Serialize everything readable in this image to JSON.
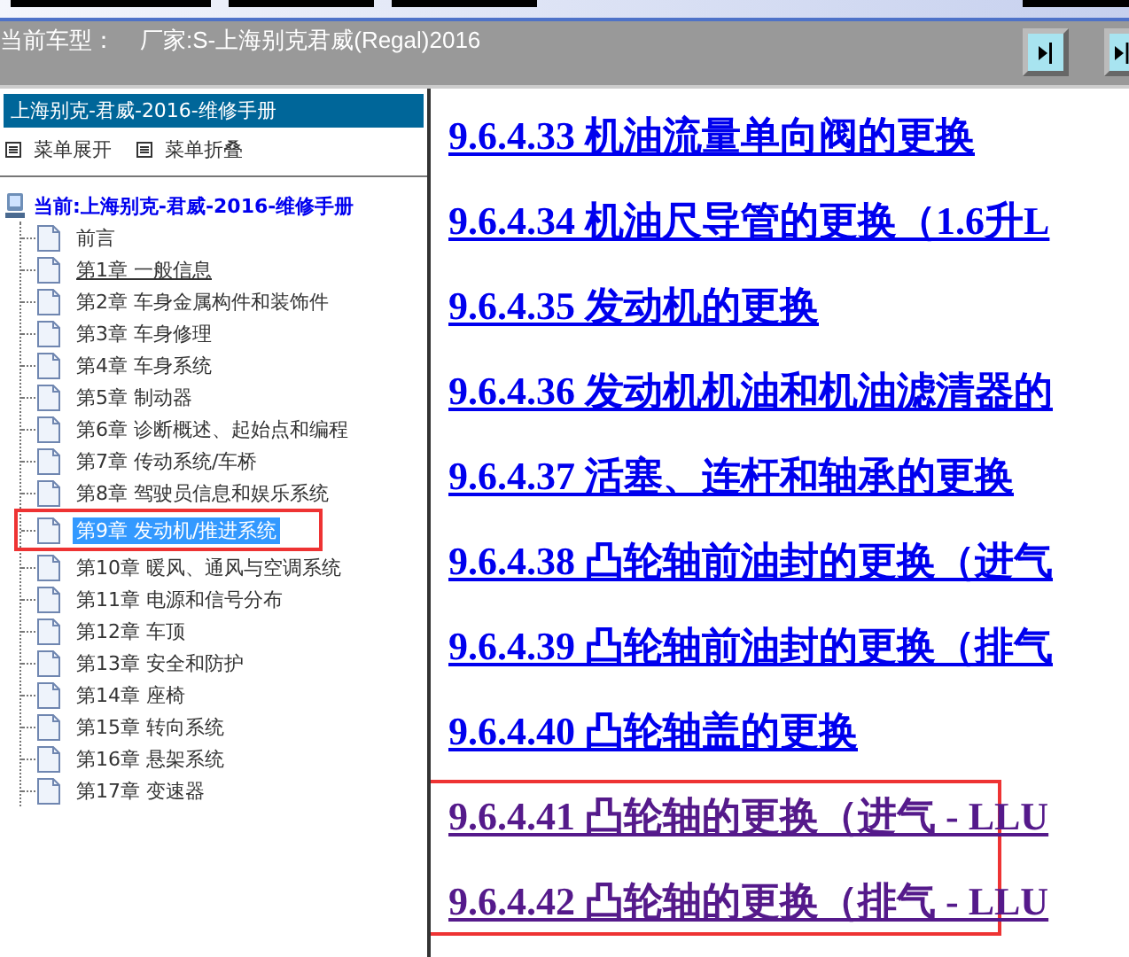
{
  "vehicle_bar": {
    "label": "当前车型：",
    "value": "厂家:S-上海别克君威(Regal)2016"
  },
  "sidebar": {
    "title": "上海别克-君威-2016-维修手册",
    "menu_actions": [
      {
        "label": "菜单展开"
      },
      {
        "label": "菜单折叠"
      }
    ],
    "tree": {
      "label": "当前:上海别克-君威-2016-维修手册",
      "children": [
        {
          "label": "前言",
          "selected": false,
          "hovered": false,
          "highlighted": false
        },
        {
          "label": "第1章 一般信息",
          "selected": false,
          "hovered": true,
          "highlighted": false
        },
        {
          "label": "第2章 车身金属构件和装饰件",
          "selected": false,
          "hovered": false,
          "highlighted": false
        },
        {
          "label": "第3章 车身修理",
          "selected": false,
          "hovered": false,
          "highlighted": false
        },
        {
          "label": "第4章 车身系统",
          "selected": false,
          "hovered": false,
          "highlighted": false
        },
        {
          "label": "第5章 制动器",
          "selected": false,
          "hovered": false,
          "highlighted": false
        },
        {
          "label": "第6章 诊断概述、起始点和编程",
          "selected": false,
          "hovered": false,
          "highlighted": false
        },
        {
          "label": "第7章 传动系统/车桥",
          "selected": false,
          "hovered": false,
          "highlighted": false
        },
        {
          "label": "第8章 驾驶员信息和娱乐系统",
          "selected": false,
          "hovered": false,
          "highlighted": false
        },
        {
          "label": "第9章 发动机/推进系统",
          "selected": true,
          "hovered": false,
          "highlighted": true
        },
        {
          "label": "第10章 暖风、通风与空调系统",
          "selected": false,
          "hovered": false,
          "highlighted": false
        },
        {
          "label": "第11章 电源和信号分布",
          "selected": false,
          "hovered": false,
          "highlighted": false
        },
        {
          "label": "第12章 车顶",
          "selected": false,
          "hovered": false,
          "highlighted": false
        },
        {
          "label": "第13章 安全和防护",
          "selected": false,
          "hovered": false,
          "highlighted": false
        },
        {
          "label": "第14章 座椅",
          "selected": false,
          "hovered": false,
          "highlighted": false
        },
        {
          "label": "第15章 转向系统",
          "selected": false,
          "hovered": false,
          "highlighted": false
        },
        {
          "label": "第16章 悬架系统",
          "selected": false,
          "hovered": false,
          "highlighted": false
        },
        {
          "label": "第17章 变速器",
          "selected": false,
          "hovered": false,
          "highlighted": false
        }
      ]
    }
  },
  "content": {
    "links": [
      {
        "label": "9.6.4.33 机油流量单向阀的更换",
        "visited": false
      },
      {
        "label": "9.6.4.34 机油尺导管的更换（1.6升L",
        "visited": false
      },
      {
        "label": "9.6.4.35 发动机的更换",
        "visited": false
      },
      {
        "label": "9.6.4.36 发动机机油和机油滤清器的",
        "visited": false
      },
      {
        "label": "9.6.4.37 活塞、连杆和轴承的更换",
        "visited": false
      },
      {
        "label": "9.6.4.38 凸轮轴前油封的更换（进气",
        "visited": false
      },
      {
        "label": "9.6.4.39 凸轮轴前油封的更换（排气",
        "visited": false
      },
      {
        "label": "9.6.4.40 凸轮轴盖的更换",
        "visited": false
      }
    ],
    "highlighted_links": [
      {
        "label": "9.6.4.41 凸轮轴的更换（进气 - LLU",
        "visited": true
      },
      {
        "label": "9.6.4.42 凸轮轴的更换（排气 - LLU",
        "visited": true
      }
    ]
  }
}
